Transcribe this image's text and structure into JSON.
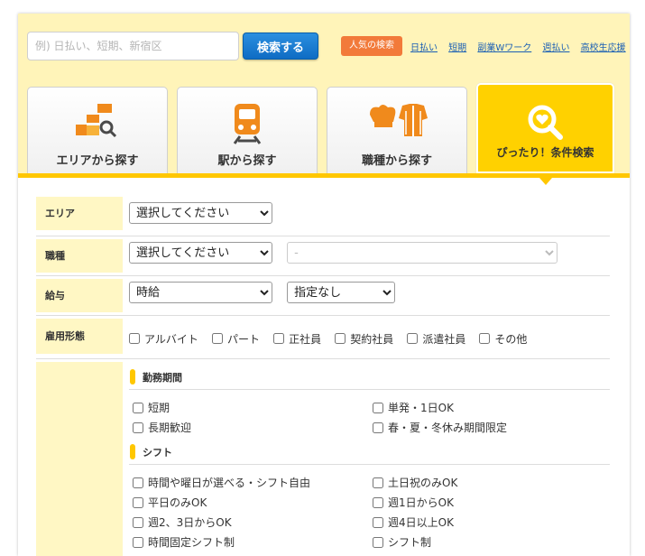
{
  "search": {
    "placeholder": "例) 日払い、短期、新宿区",
    "button_label": "検索する",
    "popular_label": "人気の検索",
    "popular_links": [
      "日払い",
      "短期",
      "副業Wワーク",
      "週払い",
      "高校生応援"
    ]
  },
  "tabs": [
    {
      "label": "エリアから探す",
      "icon": "area-map-icon"
    },
    {
      "label": "駅から探す",
      "icon": "train-icon"
    },
    {
      "label": "職種から探す",
      "icon": "uniform-icon"
    },
    {
      "label": "ぴったり！条件検索",
      "icon": "magnifier-heart-icon",
      "active": true
    }
  ],
  "colors": {
    "accent": "#ffc700",
    "tab_active": "#ffd100",
    "topbar": "#fff4b9",
    "label_bg": "#fff7c4",
    "orange": "#f27a3a",
    "button_blue": "#0f6cc4"
  },
  "form": {
    "area": {
      "label": "エリア",
      "select_value": "選択してください"
    },
    "job": {
      "label": "職種",
      "select_value": "選択してください",
      "sub_select_value": "-"
    },
    "salary": {
      "label": "給与",
      "type_value": "時給",
      "amount_value": "指定なし"
    },
    "employment": {
      "label": "雇用形態",
      "options": [
        "アルバイト",
        "パート",
        "正社員",
        "契約社員",
        "派遣社員",
        "その他"
      ]
    },
    "period": {
      "title": "勤務期間",
      "options": [
        "短期",
        "単発・1日OK",
        "長期歓迎",
        "春・夏・冬休み期間限定"
      ]
    },
    "shift": {
      "title": "シフト",
      "options": [
        "時間や曜日が選べる・シフト自由",
        "土日祝のみOK",
        "平日のみOK",
        "週1日からOK",
        "週2、3日からOK",
        "週4日以上OK",
        "時間固定シフト制",
        "シフト制"
      ]
    }
  }
}
